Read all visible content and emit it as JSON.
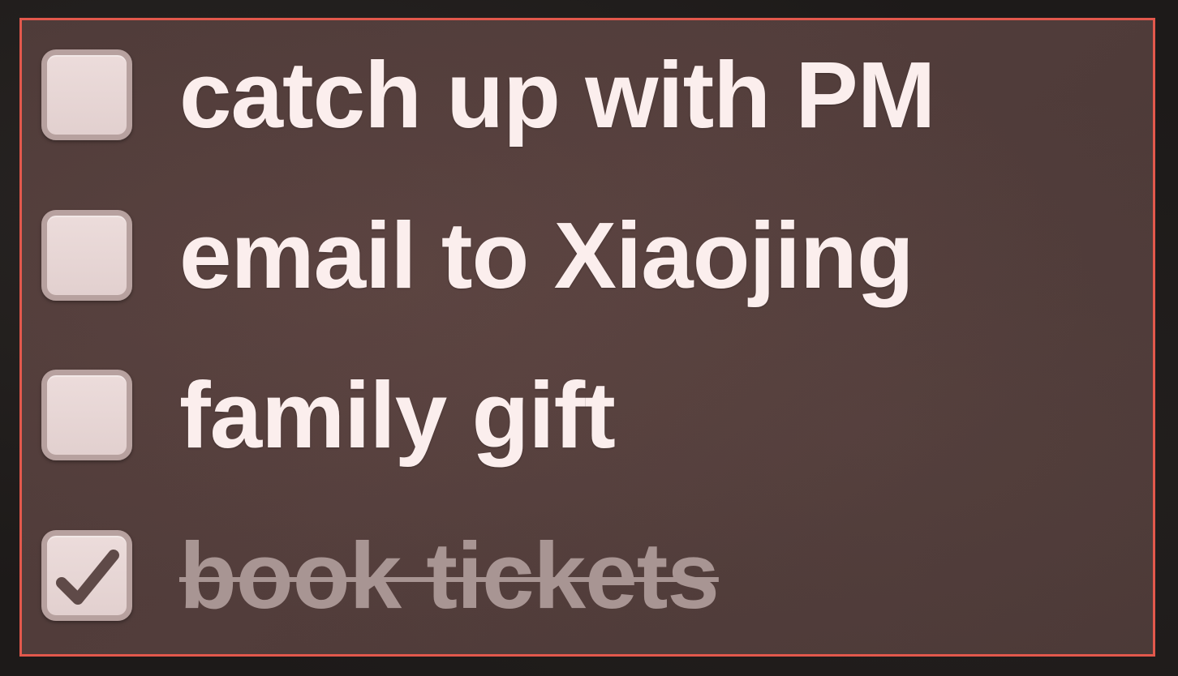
{
  "todo": {
    "items": [
      {
        "label": "catch up with PM",
        "checked": false
      },
      {
        "label": "email to Xiaojing",
        "checked": false
      },
      {
        "label": "family gift",
        "checked": false
      },
      {
        "label": "book tickets",
        "checked": true
      }
    ],
    "check_icon": "checkmark-icon"
  },
  "colors": {
    "panel_border": "#e2584c",
    "panel_background": "#4f3b39",
    "text": "#fbeeed",
    "completed_text": "#a89593",
    "checkbox_fill": "#e8d8d7",
    "checkbox_border": "#b7a19f",
    "checkmark": "#5f4a48"
  }
}
